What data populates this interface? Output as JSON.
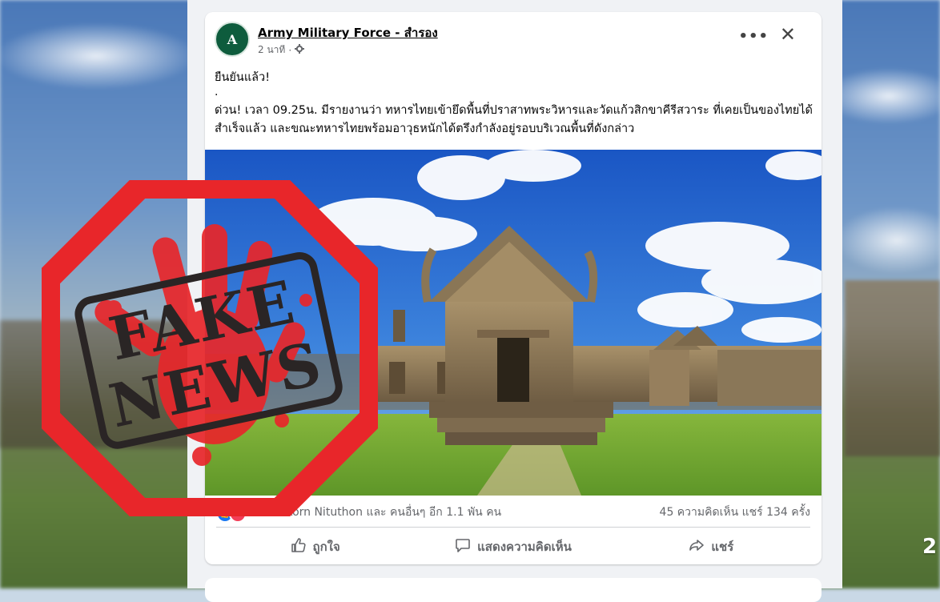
{
  "post": {
    "page_name": "Army Military Force - สำรอง",
    "avatar_letter": "A",
    "timestamp": "2 นาที",
    "separator": "·",
    "more_label": "•••",
    "close_label": "✕",
    "headline": "ยืนยันแล้ว!",
    "dot_line": ".",
    "body": "ด่วน! เวลา 09.25น. มีรายงานว่า ทหารไทยเข้ายึดพื้นที่ปราสาทพระวิหารและวัดแก้วสิกขาคีรีสวาระ ที่เคยเป็นของไทยได้สำเร็จแล้ว และขณะทหารไทยพร้อมอาวุธหนักได้ตรึงกำลังอยู่รอบบริเวณพื้นที่ดังกล่าว",
    "likers": "Thanakorn Nituthon และ คนอื่นๆ อีก 1.1 พัน คน",
    "counts": "45 ความคิดเห็น  แชร์ 134 ครั้ง",
    "actions": {
      "like": "ถูกใจ",
      "comment": "แสดงความคิดเห็น",
      "share": "แชร์"
    }
  },
  "stamp": {
    "line1": "FAKE",
    "line2": "NEWS",
    "color": "#e8262a"
  },
  "page_number": "2",
  "colors": {
    "fb_blue": "#1877f2",
    "reaction_red": "#f33e58"
  }
}
